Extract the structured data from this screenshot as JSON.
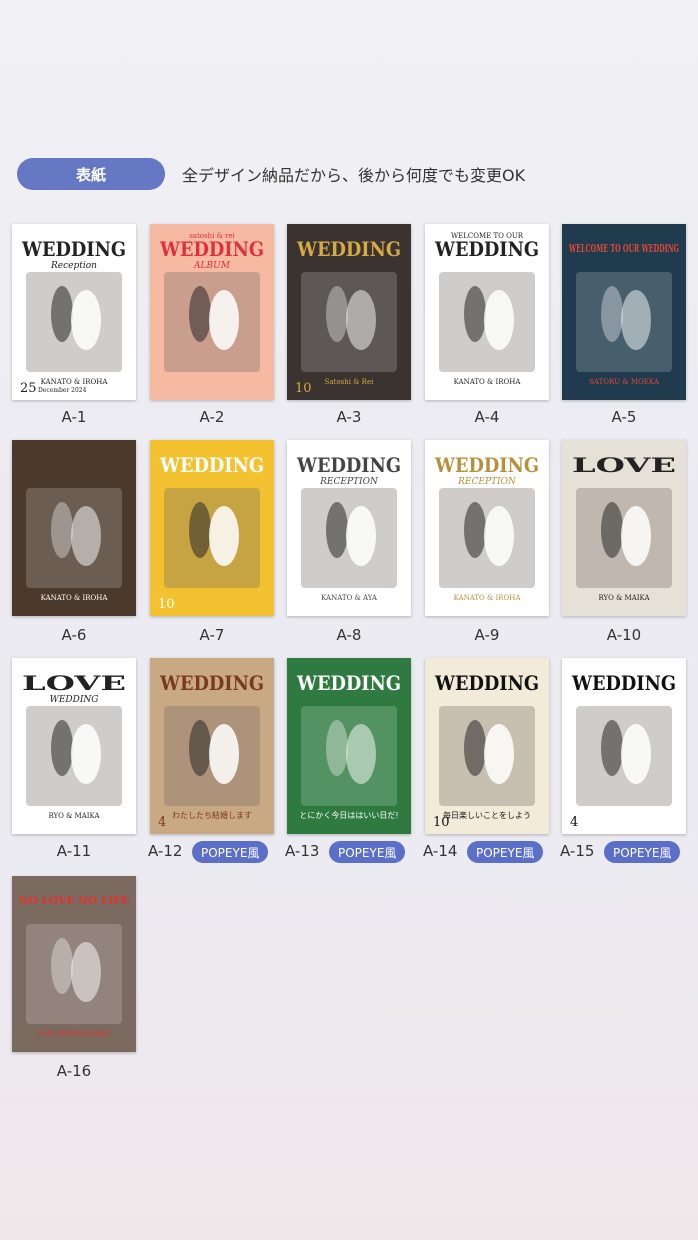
{
  "header": {
    "button_label": "表紙",
    "subtitle": "全デザイン納品だから、後から何度でも変更OK"
  },
  "badge_label": "POPEYE風",
  "items": [
    {
      "id": "A-1",
      "bg": "#ffffff",
      "fg": "#222222",
      "title": "WEDDING",
      "sub": "Reception",
      "footer": "KANATO & IROHA",
      "num": "25",
      "date": "December 2024"
    },
    {
      "id": "A-2",
      "bg": "#f6b9a2",
      "fg": "#e0303a",
      "title": "WEDDING",
      "sub": "ALBUM",
      "top": "satoshi & rei"
    },
    {
      "id": "A-3",
      "bg": "#3a3330",
      "fg": "#d6aa45",
      "title": "WEDDING",
      "num": "10",
      "footer": "Satoshi & Rei"
    },
    {
      "id": "A-4",
      "bg": "#ffffff",
      "fg": "#222222",
      "title": "WEDDING",
      "top": "WELCOME TO OUR",
      "footer": "KANATO & IROHA"
    },
    {
      "id": "A-5",
      "bg": "#1f3b4d",
      "fg": "#e34a36",
      "title": "WELCOME TO OUR WEDDING",
      "footer": "SATORU & MOEKA"
    },
    {
      "id": "A-6",
      "bg": "#4b3a2c",
      "fg": "#ffffff",
      "footer": "KANATO & IROHA"
    },
    {
      "id": "A-7",
      "bg": "#f2c230",
      "fg": "#ffffff",
      "title": "WEDDING",
      "num": "10"
    },
    {
      "id": "A-8",
      "bg": "#ffffff",
      "fg": "#444444",
      "title": "WEDDING",
      "sub": "RECEPTION",
      "footer": "KANATO & AYA"
    },
    {
      "id": "A-9",
      "bg": "#ffffff",
      "fg": "#b8903a",
      "title": "WEDDING",
      "sub": "RECEPTION",
      "footer": "KANATO & IROHA"
    },
    {
      "id": "A-10",
      "bg": "#e6e1d6",
      "fg": "#222222",
      "title": "LOVE",
      "footer": "RYO & MAIKA"
    },
    {
      "id": "A-11",
      "bg": "#ffffff",
      "fg": "#222222",
      "title": "LOVE",
      "sub": "WEDDING",
      "footer": "RYO & MAIKA"
    },
    {
      "id": "A-12",
      "bg": "#c9a884",
      "fg": "#7a3a1c",
      "title": "WEDDING",
      "tagline": "わたしたち結婚します",
      "num": "4",
      "popeye": true
    },
    {
      "id": "A-13",
      "bg": "#2e7a40",
      "fg": "#ffffff",
      "title": "WEDDING",
      "tagline": "とにかく今日ははいい日だ!",
      "popeye": true
    },
    {
      "id": "A-14",
      "bg": "#f2ebd9",
      "fg": "#111111",
      "title": "WEDDING",
      "tagline": "毎日楽しいことをしよう",
      "num": "10",
      "popeye": true
    },
    {
      "id": "A-15",
      "bg": "#ffffff",
      "fg": "#111111",
      "title": "WEDDING",
      "num": "4",
      "popeye": true
    },
    {
      "id": "A-16",
      "bg": "#7a6a60",
      "fg": "#e4312b",
      "title": "NO LOVE NO LIFE",
      "footer": "OUR WEDDINGDAY"
    }
  ]
}
